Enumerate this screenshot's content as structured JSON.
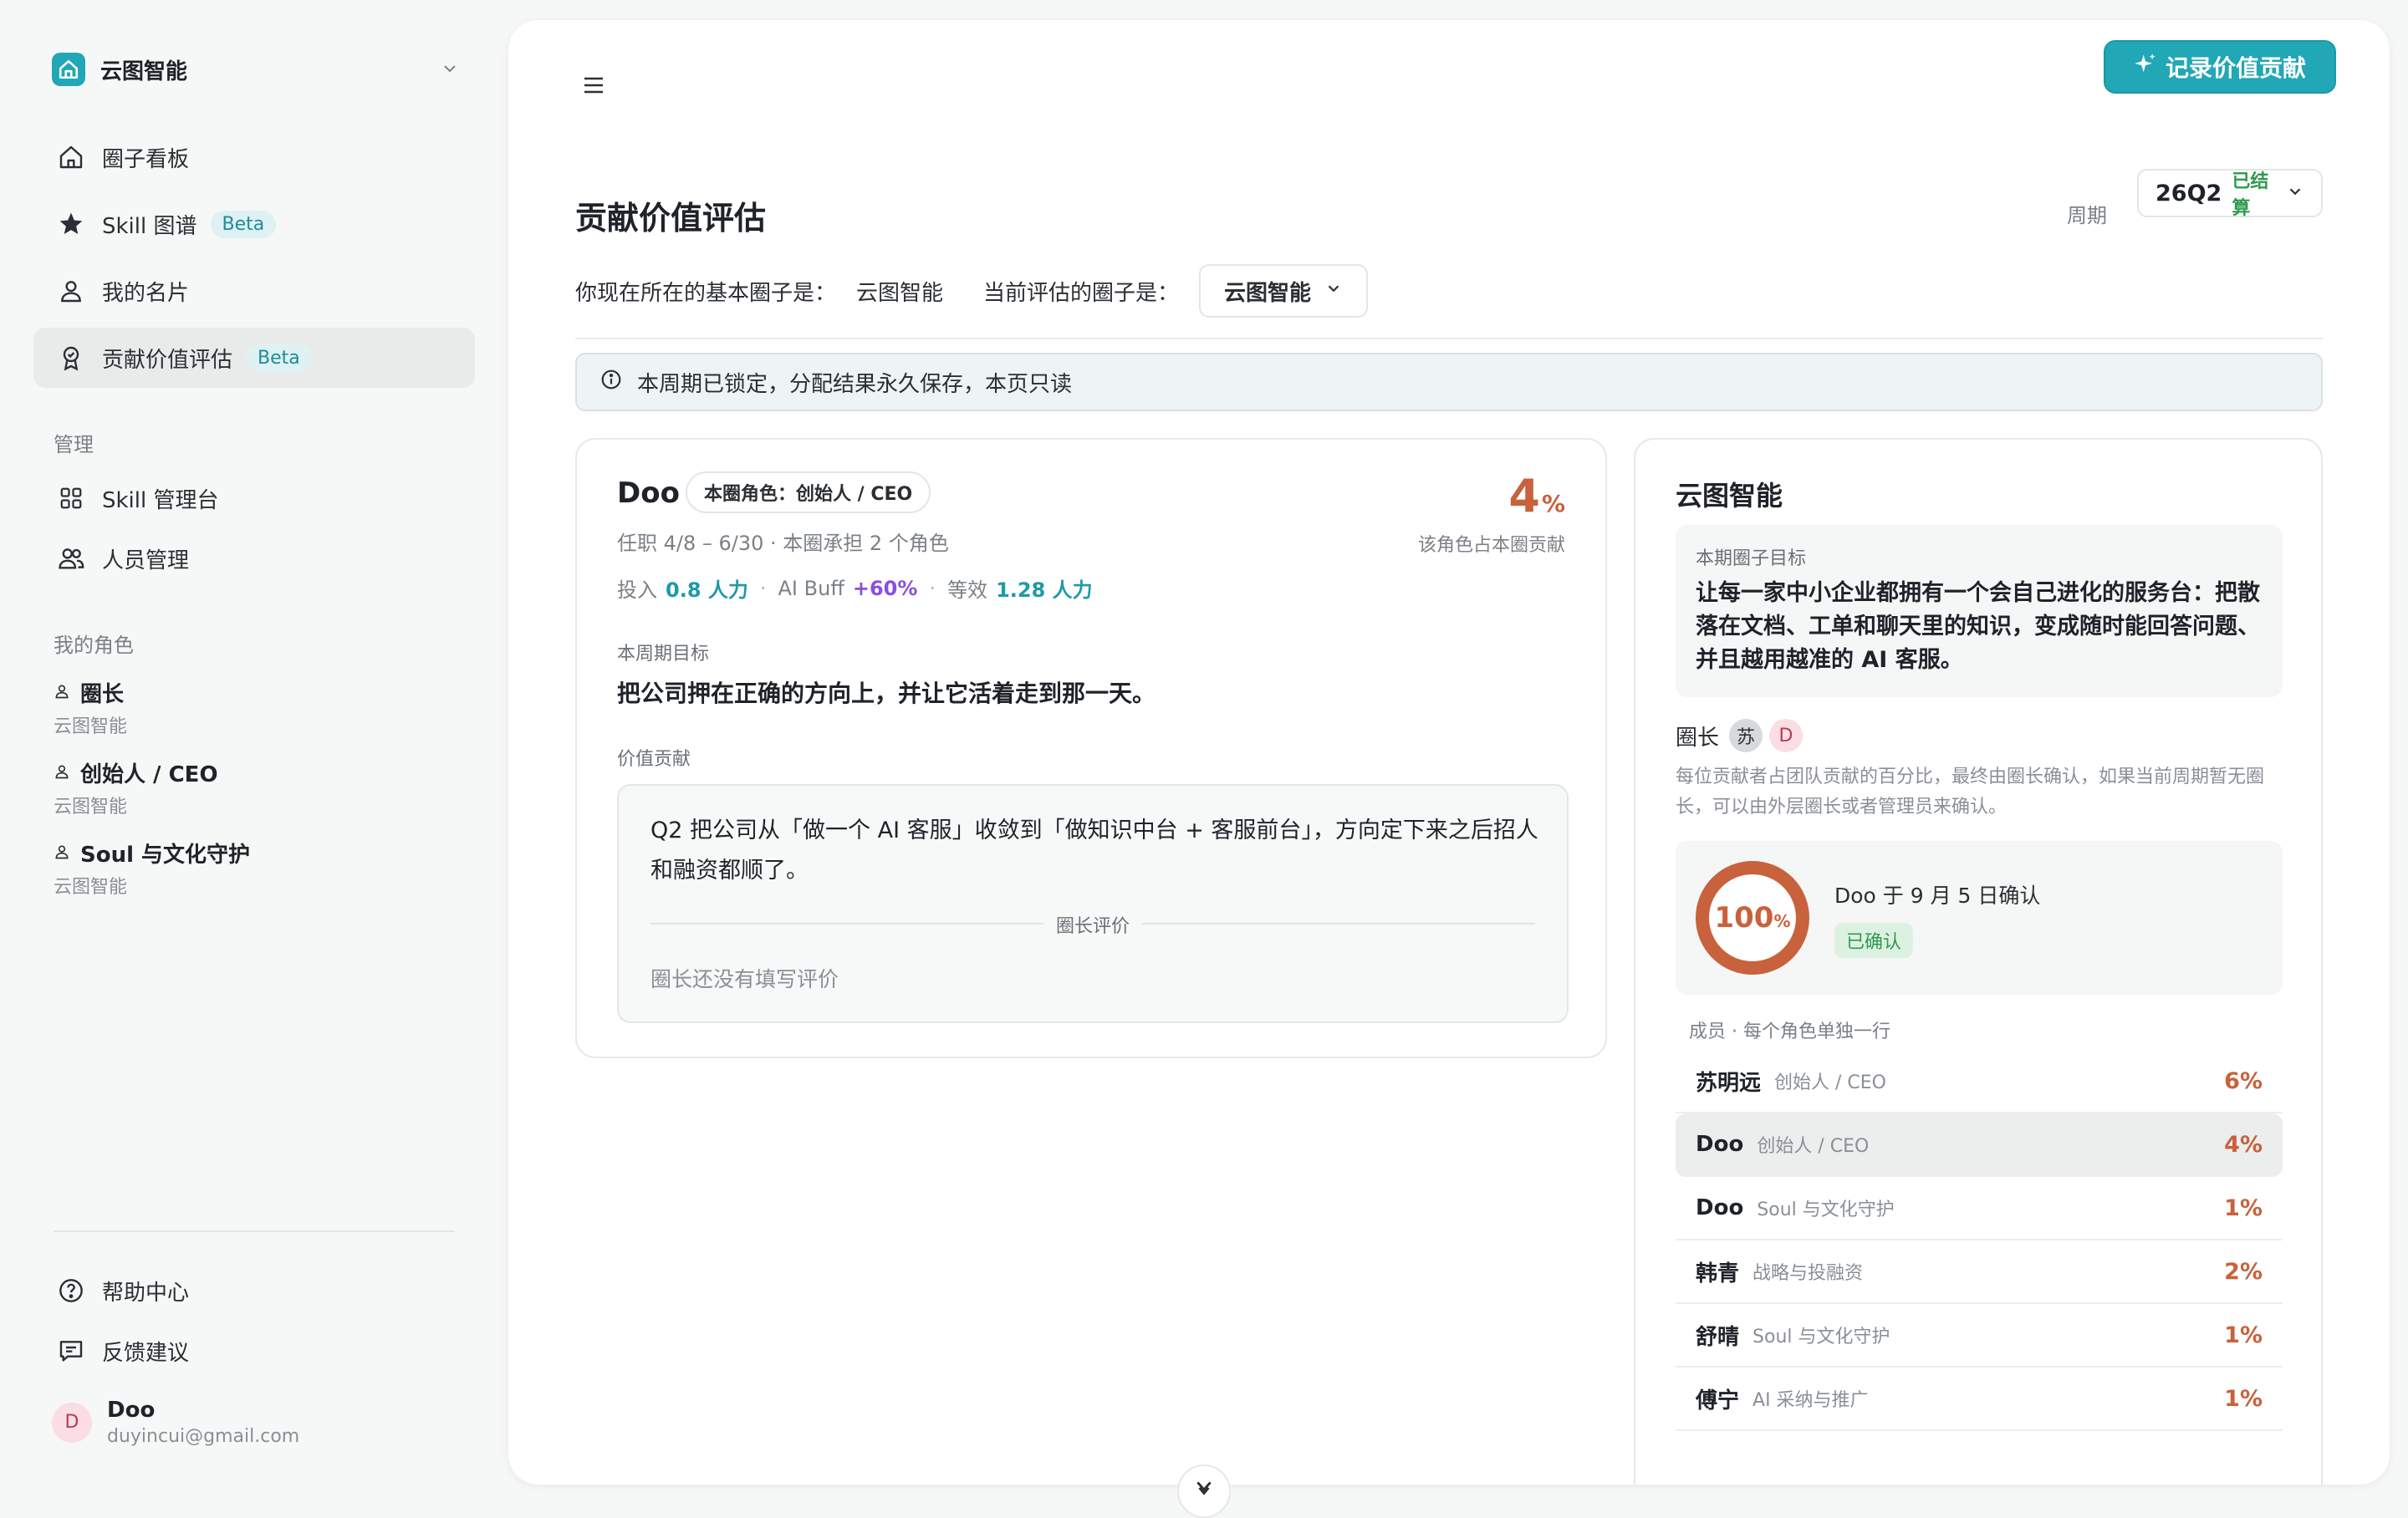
{
  "sidebar": {
    "workspace_name": "云图智能",
    "nav": [
      {
        "label": "圈子看板",
        "icon": "home-icon"
      },
      {
        "label": "Skill 图谱",
        "icon": "star-icon",
        "badge": "Beta"
      },
      {
        "label": "我的名片",
        "icon": "user-icon"
      },
      {
        "label": "贡献价值评估",
        "icon": "award-icon",
        "badge": "Beta"
      }
    ],
    "manage_title": "管理",
    "manage": [
      {
        "label": "Skill 管理台",
        "icon": "grid-icon"
      },
      {
        "label": "人员管理",
        "icon": "users-icon"
      }
    ],
    "roles_title": "我的角色",
    "roles": [
      {
        "name": "圈长",
        "circle": "云图智能"
      },
      {
        "name": "创始人 / CEO",
        "circle": "云图智能"
      },
      {
        "name": "Soul 与文化守护",
        "circle": "云图智能"
      }
    ],
    "footer": [
      {
        "label": "帮助中心",
        "icon": "help-icon"
      },
      {
        "label": "反馈建议",
        "icon": "feedback-icon"
      }
    ],
    "user": {
      "avatar": "D",
      "name": "Doo",
      "email": "duyincui@gmail.com"
    }
  },
  "header": {
    "record_button": "记录价值贡献",
    "title": "贡献价值评估",
    "period_label": "周期",
    "period_value": "26Q2",
    "period_status": "已结算"
  },
  "circle_info": {
    "base_label": "你现在所在的基本圈子是：",
    "base_value": "云图智能",
    "eval_label": "当前评估的圈子是：",
    "eval_value": "云图智能"
  },
  "notice": "本周期已锁定，分配结果永久保存，本页只读",
  "person_card": {
    "name": "Doo",
    "role_chip": "本圈角色：创始人 / CEO",
    "pct": "4",
    "pct_unit": "%",
    "pct_caption": "该角色占本圈贡献",
    "tenure": "任职 4/8 – 6/30 · 本圈承担 2 个角色",
    "input_label": "投入",
    "input_value": "0.8 人力",
    "buff_label": "AI Buff",
    "buff_value": "+60%",
    "equiv_label": "等效",
    "equiv_value": "1.28 人力",
    "goal_label": "本周期目标",
    "goal_text": "把公司押在正确的方向上，并让它活着走到那一天。",
    "contrib_label": "价值贡献",
    "contrib_text": "Q2 把公司从「做一个 AI 客服」收敛到「做知识中台 + 客服前台」，方向定下来之后招人和融资都顺了。",
    "review_label": "圈长评价",
    "review_empty": "圈长还没有填写评价"
  },
  "circle_card": {
    "title": "云图智能",
    "goal_label": "本期圈子目标",
    "goal_text": "让每一家中小企业都拥有一个会自己进化的服务台：把散落在文档、工单和聊天里的知识，变成随时能回答问题、并且越用越准的 AI 客服。",
    "leader_label": "圈长",
    "leader_avatars": [
      "苏",
      "D"
    ],
    "leader_desc": "每位贡献者占团队贡献的百分比，最终由圈长确认，如果当前周期暂无圈长，可以由外层圈长或者管理员来确认。",
    "confirm_pct": 100,
    "confirm_pct_text": "100",
    "confirm_pct_unit": "%",
    "confirm_by": "Doo 于 9 月 5 日确认",
    "confirm_status": "已确认",
    "members_label": "成员 · 每个角色单独一行",
    "members": [
      {
        "name": "苏明远",
        "role": "创始人 / CEO",
        "pct": "6%"
      },
      {
        "name": "Doo",
        "role": "创始人 / CEO",
        "pct": "4%"
      },
      {
        "name": "Doo",
        "role": "Soul 与文化守护",
        "pct": "1%"
      },
      {
        "name": "韩青",
        "role": "战略与投融资",
        "pct": "2%"
      },
      {
        "name": "舒晴",
        "role": "Soul 与文化守护",
        "pct": "1%"
      },
      {
        "name": "傅宁",
        "role": "AI 采纳与推广",
        "pct": "1%"
      }
    ]
  },
  "colors": {
    "accent": "#21a7b5",
    "percent": "#c8623c",
    "buff": "#8a4fe0",
    "success": "#2e9a4e"
  }
}
